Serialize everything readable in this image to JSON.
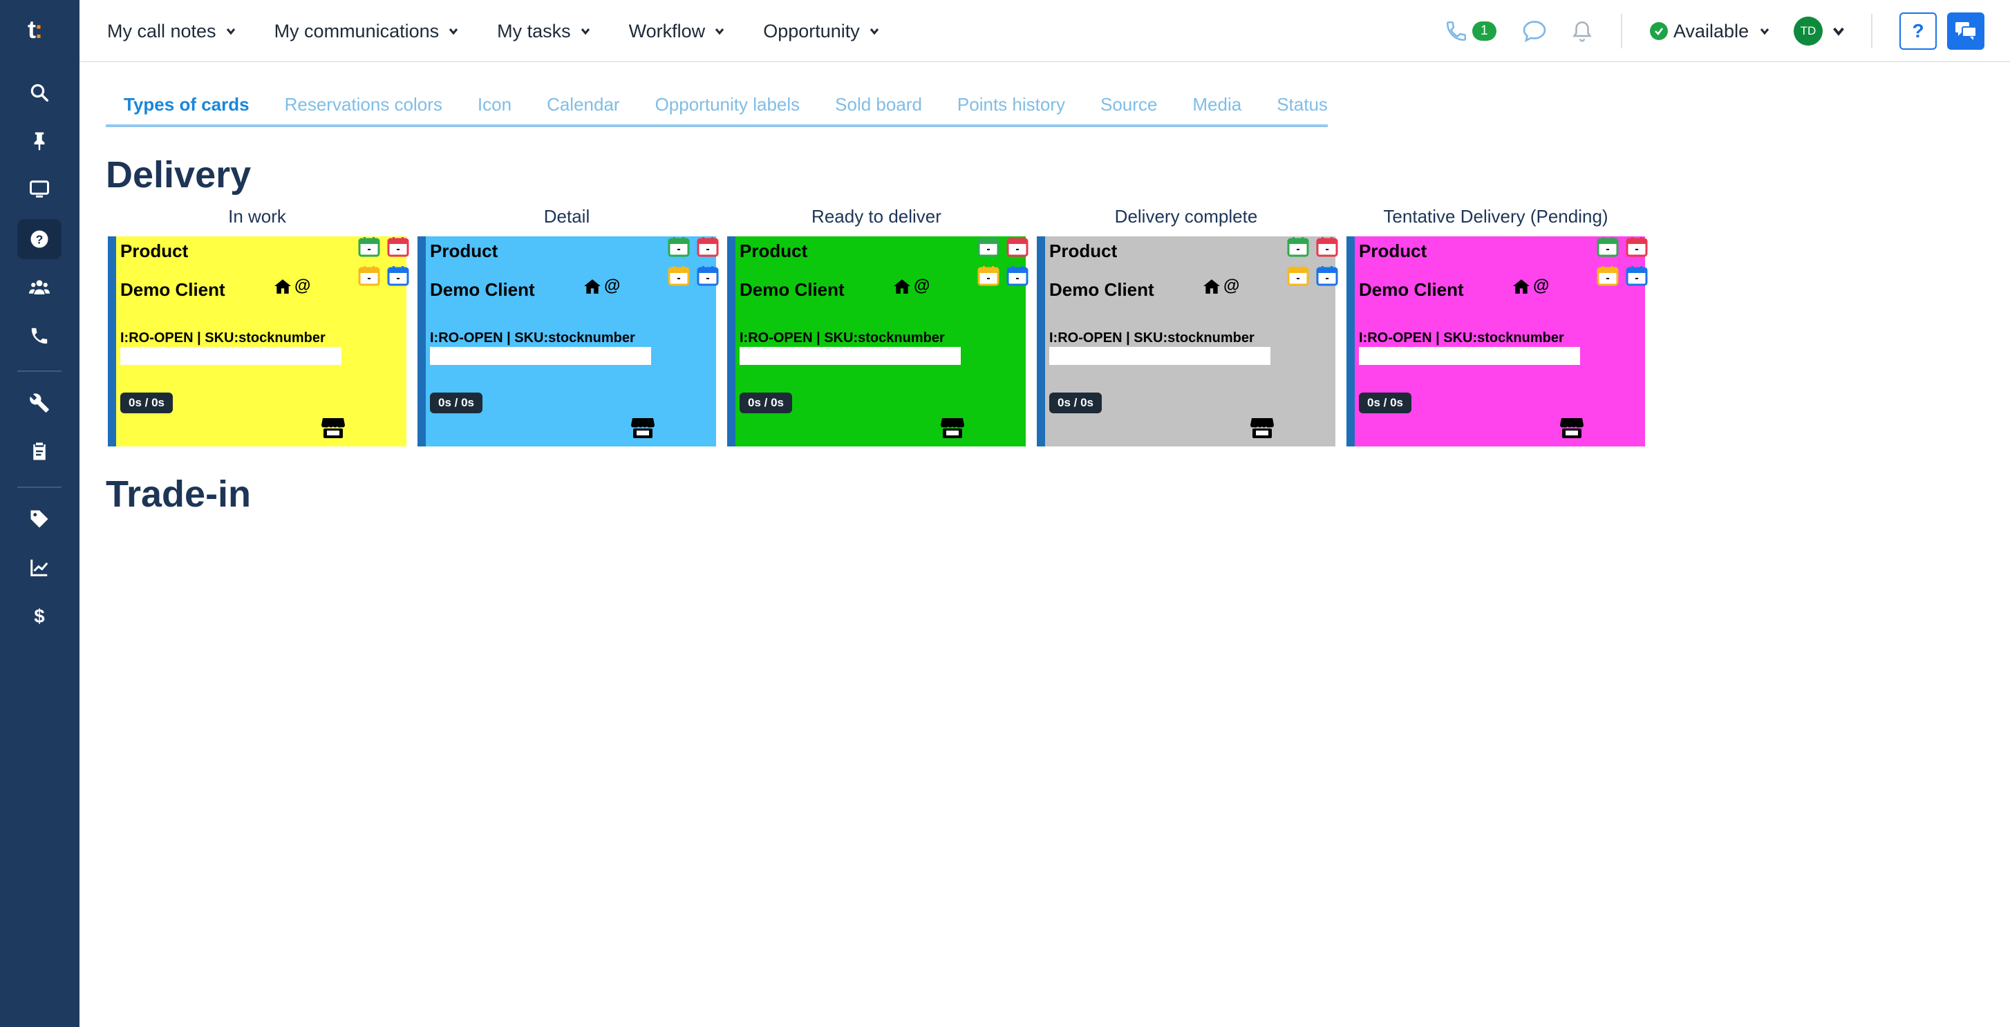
{
  "logo": {
    "text": "t",
    "dot": ":"
  },
  "topnav": [
    {
      "label": "My call notes"
    },
    {
      "label": "My communications"
    },
    {
      "label": "My tasks"
    },
    {
      "label": "Workflow"
    },
    {
      "label": "Opportunity"
    }
  ],
  "topright": {
    "call_count": "1",
    "status": "Available",
    "avatar_initials": "TD",
    "help": "?"
  },
  "tabs": [
    {
      "label": "Types of cards",
      "active": true
    },
    {
      "label": "Reservations colors"
    },
    {
      "label": "Icon"
    },
    {
      "label": "Calendar"
    },
    {
      "label": "Opportunity labels"
    },
    {
      "label": "Sold board"
    },
    {
      "label": "Points history"
    },
    {
      "label": "Source"
    },
    {
      "label": "Media"
    },
    {
      "label": "Status"
    }
  ],
  "sections": {
    "delivery": "Delivery",
    "tradein": "Trade-in"
  },
  "columns": [
    {
      "title": "In work",
      "color": "#ffff44"
    },
    {
      "title": "Detail",
      "color": "#4fc1fb"
    },
    {
      "title": "Ready to deliver",
      "color": "#0cc80c"
    },
    {
      "title": "Delivery complete",
      "color": "#c2c2c2"
    },
    {
      "title": "Tentative Delivery (Pending)",
      "color": "#ff44ee"
    }
  ],
  "card": {
    "product": "Product",
    "client": "Demo Client",
    "at": "@",
    "info": "I:RO-OPEN | SKU:stocknumber",
    "timer": "0s / 0s",
    "cal_label": "-"
  },
  "icons": {
    "sidebar": [
      "search-icon",
      "pin-icon",
      "monitor-icon",
      "question-icon",
      "users-icon",
      "phone-icon",
      "wrench-icon",
      "clipboard-icon",
      "tag-icon",
      "chart-icon",
      "dollar-icon"
    ],
    "calendar_colors": [
      "#2fa84f",
      "#e53950",
      "#f5b91b",
      "#1a73e8"
    ]
  }
}
